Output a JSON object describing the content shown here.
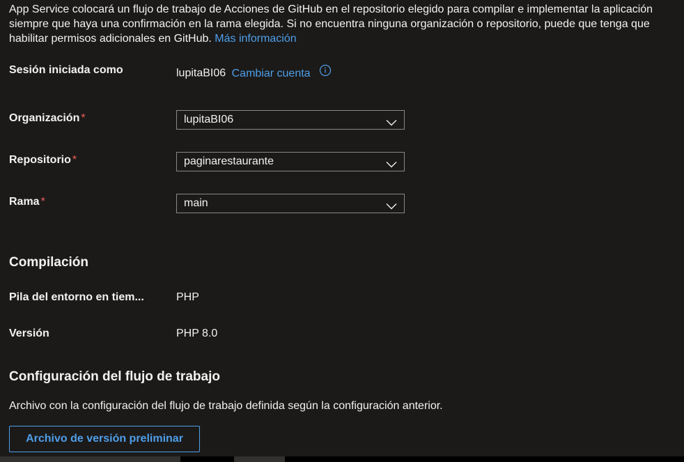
{
  "intro": {
    "text": "App Service colocará un flujo de trabajo de Acciones de GitHub en el repositorio elegido para compilar e implementar la aplicación siempre que haya una confirmación en la rama elegida. Si no encuentra ninguna organización o repositorio, puede que tenga que habilitar permisos adicionales en GitHub.",
    "link": "Más información"
  },
  "signin": {
    "label": "Sesión iniciada como",
    "user": "lupitaBI06",
    "change_link": "Cambiar cuenta",
    "info_icon": "info-circle-icon"
  },
  "fields": {
    "organization": {
      "label": "Organización",
      "required": "*",
      "value": "lupitaBI06"
    },
    "repository": {
      "label": "Repositorio",
      "required": "*",
      "value": "paginarestaurante"
    },
    "branch": {
      "label": "Rama",
      "required": "*",
      "value": "main"
    }
  },
  "build": {
    "title": "Compilación",
    "runtime_label": "Pila del entorno en tiem...",
    "runtime_value": "PHP",
    "version_label": "Versión",
    "version_value": "PHP 8.0"
  },
  "workflow": {
    "title": "Configuración del flujo de trabajo",
    "description": "Archivo con la configuración del flujo de trabajo definida según la configuración anterior.",
    "preview_button": "Archivo de versión preliminar"
  },
  "colors": {
    "background": "#1b1a19",
    "text": "#f3f2f1",
    "link": "#4f9ee9",
    "required": "#ef5c5c",
    "border": "#8a8886"
  }
}
